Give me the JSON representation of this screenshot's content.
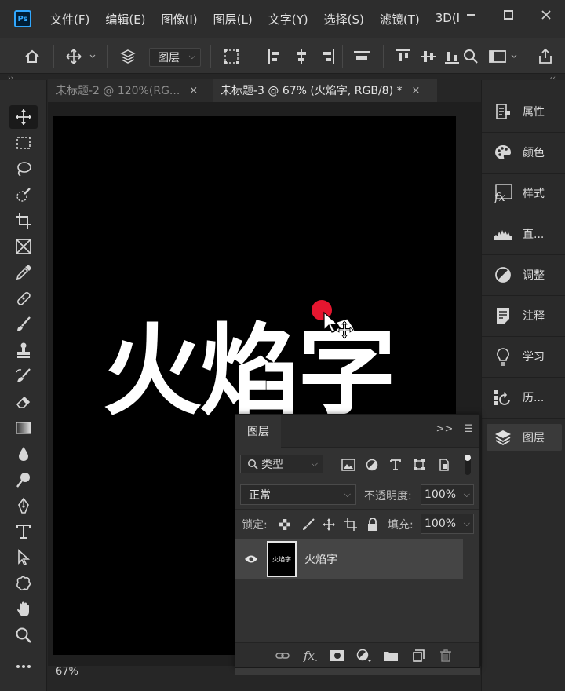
{
  "app": {
    "logo": "Ps",
    "menu": [
      "文件(F)",
      "编辑(E)",
      "图像(I)",
      "图层(L)",
      "文字(Y)",
      "选择(S)",
      "滤镜(T)",
      "3D(I"
    ],
    "window_controls": [
      "minimize-icon",
      "restore-icon",
      "close-icon"
    ]
  },
  "options_bar": {
    "auto_select_target": "图层",
    "icons": [
      "home-icon",
      "move-tool-icon",
      "layers-stack-icon",
      "transform-controls-icon",
      "align-left-icon",
      "align-center-h-icon",
      "align-right-icon",
      "distribute-icon",
      "align-top-icon",
      "align-middle-v-icon",
      "align-bottom-icon",
      "search-icon",
      "workspace-icon",
      "share-icon"
    ]
  },
  "tabs": [
    {
      "label": "未标题-2 @ 120%(RG...",
      "close": "×"
    },
    {
      "label": "未标题-3 @ 67% (火焰字, RGB/8) *",
      "close": "×"
    }
  ],
  "canvas": {
    "text": "火焰字",
    "background": "#000000",
    "text_color": "#ffffff",
    "cursor_dot_color": "#e5162f"
  },
  "status": {
    "zoom": "67%"
  },
  "tools": [
    "move-tool",
    "marquee-tool",
    "lasso-tool",
    "quick-select-tool",
    "crop-tool",
    "frame-tool",
    "eyedropper-tool",
    "healing-brush-tool",
    "brush-tool",
    "clone-stamp-tool",
    "history-brush-tool",
    "eraser-tool",
    "gradient-tool",
    "blur-tool",
    "dodge-tool",
    "pen-tool",
    "type-tool",
    "path-select-tool",
    "shape-tool",
    "hand-tool",
    "zoom-tool",
    "more-tools"
  ],
  "dock": {
    "items": [
      {
        "label": "属性",
        "icon": "properties-icon"
      },
      {
        "label": "颜色",
        "icon": "color-palette-icon"
      },
      {
        "label": "样式",
        "icon": "styles-fx-icon"
      },
      {
        "label": "直...",
        "icon": "histogram-icon"
      },
      {
        "label": "调整",
        "icon": "adjustments-icon"
      },
      {
        "label": "注释",
        "icon": "notes-icon"
      },
      {
        "label": "学习",
        "icon": "lightbulb-icon"
      },
      {
        "label": "历...",
        "icon": "history-icon"
      },
      {
        "label": "图层",
        "icon": "layers-icon"
      }
    ]
  },
  "layers_panel": {
    "title": "图层",
    "filter": "类型",
    "blend_mode": "正常",
    "opacity_label": "不透明度:",
    "opacity": "100%",
    "lock_label": "锁定:",
    "fill_label": "填充:",
    "fill": "100%",
    "layers": [
      {
        "name": "火焰字",
        "thumb_text": "火焰字",
        "visible": true
      }
    ]
  }
}
